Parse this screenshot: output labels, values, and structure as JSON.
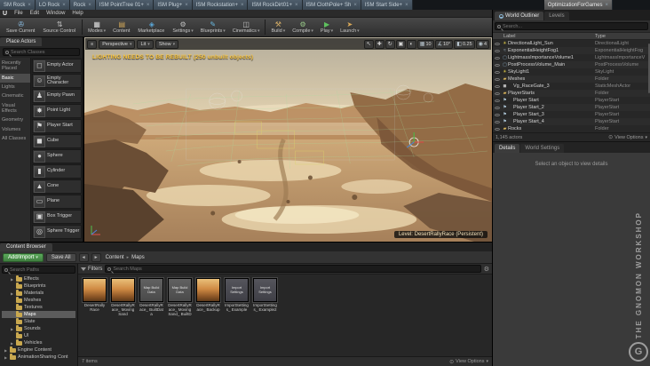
{
  "app": {
    "logo_glyph": "U",
    "doc_tabs": [
      {
        "label": "SM Rock"
      },
      {
        "label": "LO Rock"
      },
      {
        "label": "Rock"
      },
      {
        "label": "ISM PointTree 01+"
      },
      {
        "label": "ISM Plug+"
      },
      {
        "label": "ISM Rockstation+"
      },
      {
        "label": "ISM RockDirt01+"
      },
      {
        "label": "ISM ClothPole+ Sh"
      },
      {
        "label": "ISM Start Side+"
      }
    ],
    "active_doc_tab": "OptimizationForGames",
    "menu_items": [
      {
        "label": "File"
      },
      {
        "label": "Edit"
      },
      {
        "label": "Window"
      },
      {
        "label": "Help"
      }
    ]
  },
  "toolbar": {
    "buttons": [
      {
        "label": "Save Current",
        "glyph": "✇"
      },
      {
        "label": "Source Control",
        "glyph": "⇅"
      },
      {
        "label": "Modes",
        "glyph": "▦"
      },
      {
        "label": "Content",
        "glyph": "▤"
      },
      {
        "label": "Marketplace",
        "glyph": "◈"
      },
      {
        "label": "Settings",
        "glyph": "⚙"
      },
      {
        "label": "Blueprints",
        "glyph": "✎"
      },
      {
        "label": "Cinematics",
        "glyph": "◫"
      },
      {
        "label": "Build",
        "glyph": "⚒"
      },
      {
        "label": "Compile",
        "glyph": "⚙"
      },
      {
        "label": "Play",
        "glyph": "▶"
      },
      {
        "label": "Launch",
        "glyph": "➤"
      }
    ]
  },
  "place": {
    "title": "Place Actors",
    "search_placeholder": "Search Classes",
    "categories": [
      {
        "label": "Recently Placed",
        "cls": ""
      },
      {
        "label": "Basic",
        "cls": "sel"
      },
      {
        "label": "Lights",
        "cls": ""
      },
      {
        "label": "Cinematic",
        "cls": ""
      },
      {
        "label": "Visual Effects",
        "cls": ""
      },
      {
        "label": "Geometry",
        "cls": ""
      },
      {
        "label": "Volumes",
        "cls": ""
      },
      {
        "label": "All Classes",
        "cls": ""
      }
    ],
    "items": [
      {
        "label": "Empty Actor",
        "glyph": "◻"
      },
      {
        "label": "Empty Character",
        "glyph": "☺"
      },
      {
        "label": "Empty Pawn",
        "glyph": "♟"
      },
      {
        "label": "Point Light",
        "glyph": "✸"
      },
      {
        "label": "Player Start",
        "glyph": "⚑"
      },
      {
        "label": "Cube",
        "glyph": "◼"
      },
      {
        "label": "Sphere",
        "glyph": "●"
      },
      {
        "label": "Cylinder",
        "glyph": "▮"
      },
      {
        "label": "Cone",
        "glyph": "▲"
      },
      {
        "label": "Plane",
        "glyph": "▭"
      },
      {
        "label": "Box Trigger",
        "glyph": "▣"
      },
      {
        "label": "Sphere Trigger",
        "glyph": "◎"
      }
    ]
  },
  "viewport": {
    "menu_glyph": "≡",
    "mode_buttons": [
      {
        "label": "Perspective"
      },
      {
        "label": "Lit"
      },
      {
        "label": "Show"
      }
    ],
    "tools": [
      {
        "glyph": "↖"
      },
      {
        "glyph": "✚"
      },
      {
        "glyph": "↻"
      },
      {
        "glyph": "▣"
      },
      {
        "glyph": "◐"
      }
    ],
    "snaps": [
      {
        "glyph": "▦",
        "value": "10"
      },
      {
        "glyph": "∡",
        "value": "10°"
      },
      {
        "glyph": "◧",
        "value": "0.25"
      },
      {
        "glyph": "◉",
        "value": "4"
      }
    ],
    "warning": "LIGHTING NEEDS TO BE REBUILT (250 unbuilt objects)",
    "level_badge": "Level:  DesertRallyRace (Persistent)"
  },
  "outliner": {
    "tab_world_outliner": "World Outliner",
    "tab_levels": "Levels",
    "search_placeholder": "Search...",
    "col_label": "Label",
    "col_type": "Type",
    "rows": [
      {
        "label": "DirectionalLight_Sun",
        "type": "DirectionalLight",
        "glyph": "☀",
        "ico": "ico-sun",
        "cls": "d1"
      },
      {
        "label": "ExponentialHeightFog1",
        "type": "ExponentialHeightFog",
        "glyph": "≈",
        "ico": "ico-fog",
        "cls": "d1"
      },
      {
        "label": "LightmassImportanceVolume1",
        "type": "LightmassImportanceV",
        "glyph": "▢",
        "ico": "ico-vol",
        "cls": "d1"
      },
      {
        "label": "PostProcessVolume_Main",
        "type": "PostProcessVolume",
        "glyph": "▢",
        "ico": "ico-vol",
        "cls": "d1"
      },
      {
        "label": "SkyLight1",
        "type": "SkyLight",
        "glyph": "☀",
        "ico": "ico-sun",
        "cls": "d1"
      },
      {
        "label": "Meshes",
        "type": "Folder",
        "glyph": "▰",
        "ico": "ico-folder",
        "cls": "d1"
      },
      {
        "label": "Vg_RaceGate_3",
        "type": "StaticMeshActor",
        "glyph": "◼",
        "ico": "ico-cube",
        "cls": "d2"
      },
      {
        "label": "PlayerStarts",
        "type": "Folder",
        "glyph": "▰",
        "ico": "ico-folder",
        "cls": "d1"
      },
      {
        "label": "Player Start",
        "type": "PlayerStart",
        "glyph": "⚑",
        "ico": "ico-flag",
        "cls": "d2"
      },
      {
        "label": "Player Start_2",
        "type": "PlayerStart",
        "glyph": "⚑",
        "ico": "ico-flag",
        "cls": "d2"
      },
      {
        "label": "Player Start_3",
        "type": "PlayerStart",
        "glyph": "⚑",
        "ico": "ico-flag",
        "cls": "d2"
      },
      {
        "label": "Player Start_4",
        "type": "PlayerStart",
        "glyph": "⚑",
        "ico": "ico-flag",
        "cls": "d2"
      },
      {
        "label": "Rocks",
        "type": "Folder",
        "glyph": "▰",
        "ico": "ico-folder",
        "cls": "d1"
      }
    ],
    "footer_count": "1,145 actors",
    "view_options": "View Options"
  },
  "details": {
    "tab_details": "Details",
    "tab_world_settings": "World Settings",
    "empty_text": "Select an object to view details"
  },
  "content_browser": {
    "title": "Content Browser",
    "add_import": "Add/Import",
    "save_all": "Save All",
    "breadcrumb": [
      {
        "label": "Content"
      },
      {
        "label": "Maps"
      }
    ],
    "search_paths_placeholder": "Search Paths",
    "filters_label": "Filters",
    "search_placeholder": "Search Maps",
    "folders": [
      {
        "label": "Effects",
        "arrow": "▶",
        "cls": "d1"
      },
      {
        "label": "Blueprints",
        "arrow": "",
        "cls": "d1"
      },
      {
        "label": "Materials",
        "arrow": "▶",
        "cls": "d1"
      },
      {
        "label": "Meshes",
        "arrow": "",
        "cls": "d1"
      },
      {
        "label": "Textures",
        "arrow": "",
        "cls": "d1"
      },
      {
        "label": "Maps",
        "arrow": "",
        "cls": "d1 sel"
      },
      {
        "label": "Slate",
        "arrow": "",
        "cls": "d1"
      },
      {
        "label": "Sounds",
        "arrow": "▶",
        "cls": "d1"
      },
      {
        "label": "UI",
        "arrow": "",
        "cls": "d1"
      },
      {
        "label": "Vehicles",
        "arrow": "▶",
        "cls": "d1"
      },
      {
        "label": "Engine Content",
        "arrow": "▶",
        "cls": "d0"
      },
      {
        "label": "AnimationSharing Cont",
        "arrow": "▶",
        "cls": "d0"
      }
    ],
    "assets": [
      {
        "name": "DesertRally Race",
        "kind": "map",
        "thumb_text": ""
      },
      {
        "name": "DesertRallyRace_ Moving Sand",
        "kind": "map",
        "thumb_text": ""
      },
      {
        "name": "DesertRallyRace_ BuiltData",
        "kind": "builddata",
        "thumb_text": "Map Build Data"
      },
      {
        "name": "DesertRallyRace_ MovingSand_ BuiltData",
        "kind": "builddata",
        "thumb_text": "Map Build Data"
      },
      {
        "name": "DesertRallyRace_ Backup",
        "kind": "map",
        "thumb_text": ""
      },
      {
        "name": "ImportSettings_ Example",
        "kind": "settings",
        "thumb_text": "Import Settings"
      },
      {
        "name": "ImportSettings_ Example2",
        "kind": "settings",
        "thumb_text": "Import Settings"
      }
    ],
    "items_count": "7 items",
    "view_options": "View Options"
  },
  "watermark": {
    "text": "THE GNOMON WORKSHOP",
    "logo": "G"
  }
}
